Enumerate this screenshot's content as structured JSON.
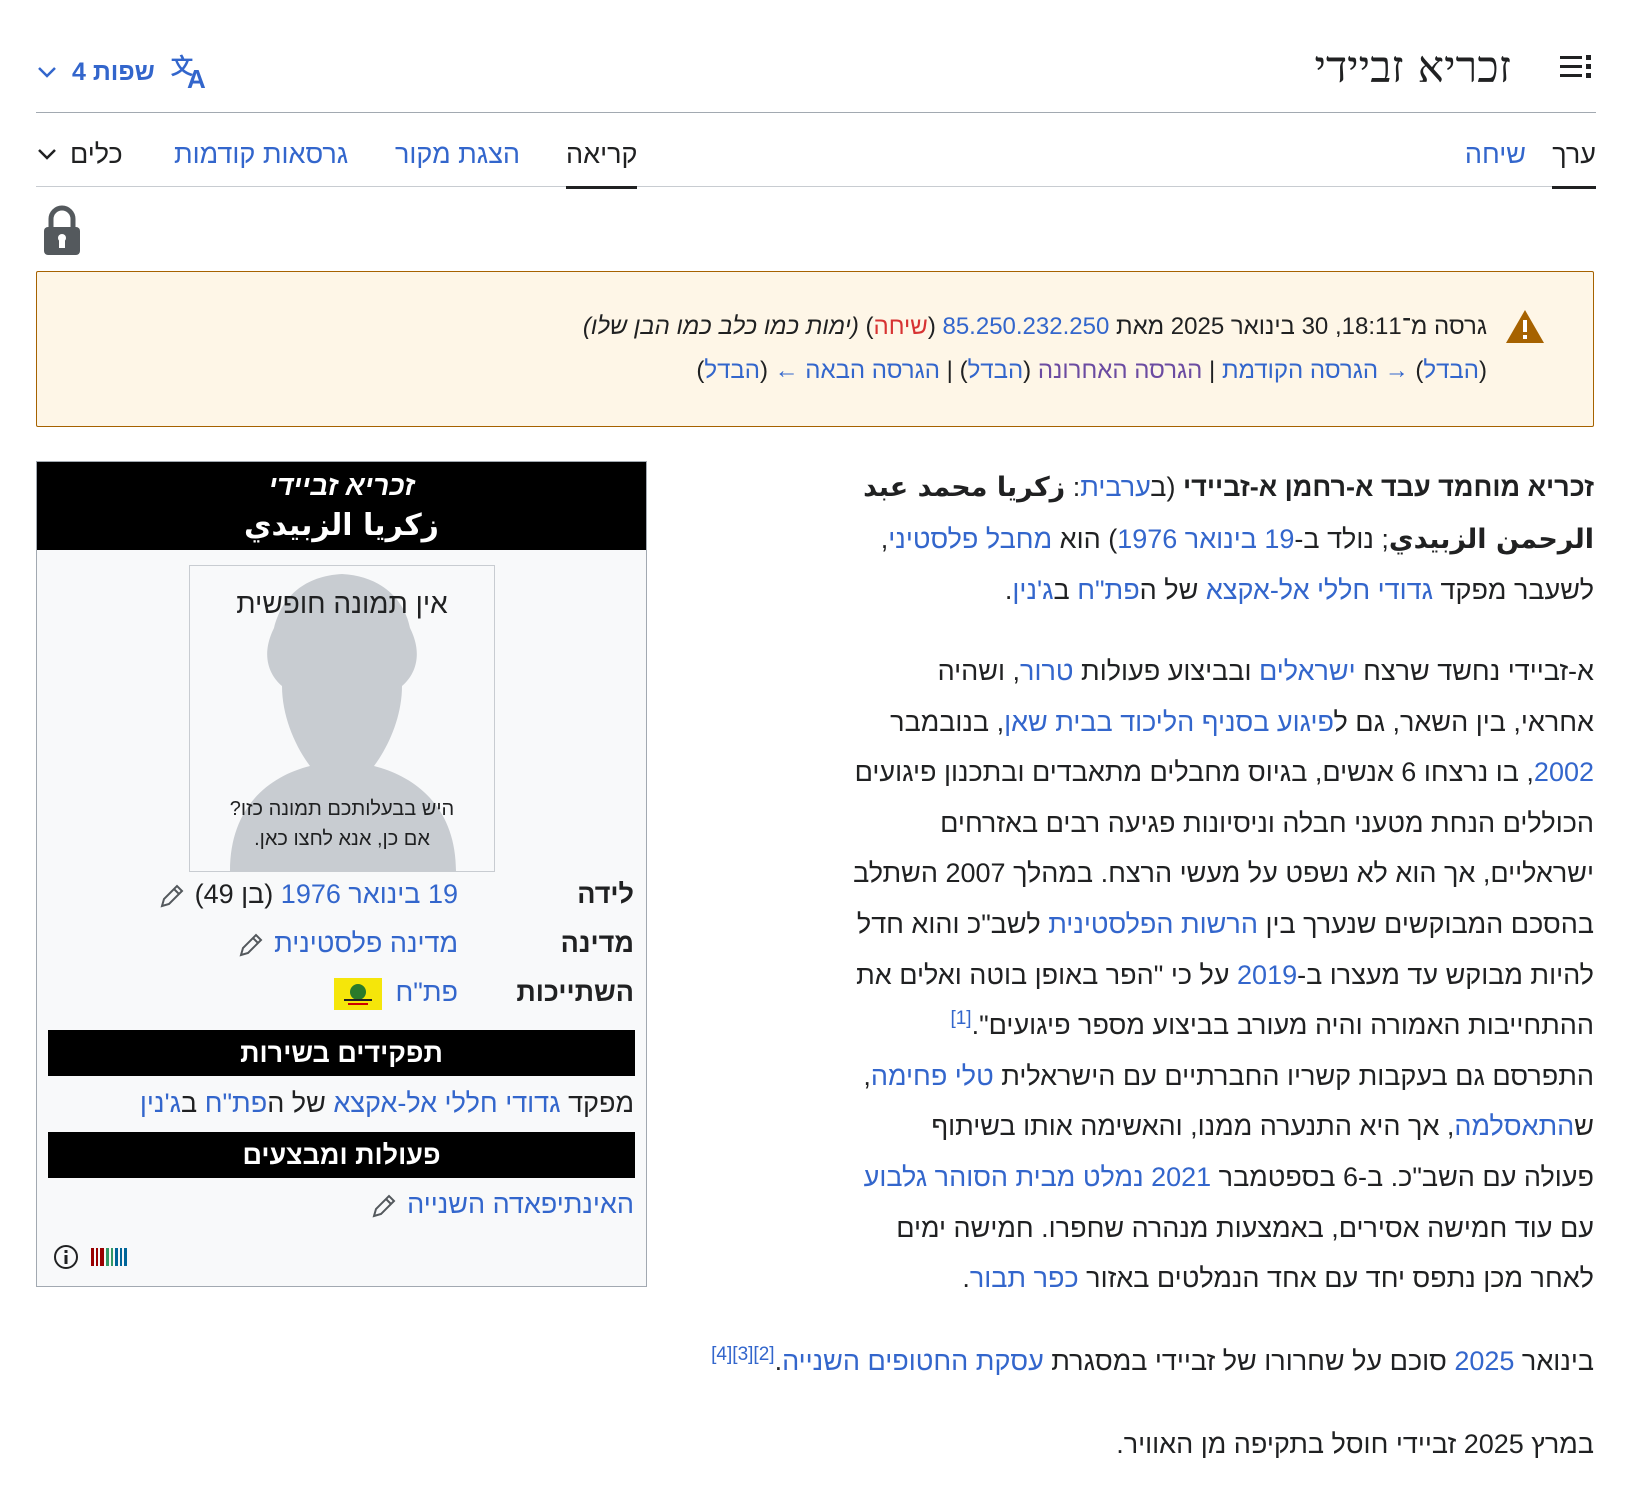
{
  "header": {
    "title": "זכריא זביידי",
    "languages_label": "4 שפות",
    "toc_icon": "toc-icon",
    "language_icon": "translate-icon"
  },
  "tabs": {
    "edit": "ערך",
    "talk": "שיחה",
    "read": "קריאה",
    "view_source": "הצגת מקור",
    "history": "גרסאות קודמות",
    "tools": "כלים"
  },
  "warning": {
    "l1_prefix": "גרסה מ־18:11, 30 בינואר 2025 מאת",
    "ip": "85.250.232.250",
    "talk_open": "(",
    "talk": "שיחה",
    "talk_close": ")",
    "summary": "(ימות כמו כלב כמו הבן שלו)",
    "diff1": "הבדל",
    "prev": "→ הגרסה הקודמת",
    "sep1": "|",
    "latest": "הגרסה האחרונה",
    "diff2": "הבדל",
    "sep2": "|",
    "next": "הגרסה הבאה ←",
    "diff3": "הבדל"
  },
  "infobox": {
    "title_he": "זכריא זביידי",
    "title_ar": "زكريا الزبيدي",
    "no_image": "אין תמונה חופשית",
    "ask_line1": "היש בבעלותכם תמונה כזו?",
    "ask_line2": "אם כן, אנא לחצו כאן.",
    "birth_label": "לידה",
    "birth_date": "19 בינואר 1976",
    "birth_age": "(בן 49)",
    "country_label": "מדינה",
    "country_value": "מדינה פלסטינית",
    "affiliation_label": "השתייכות",
    "affiliation_value": "פת\"ח",
    "roles_header": "תפקידים בשירות",
    "role_prefix": "מפקד",
    "role_unit": "גדודי חללי אל-אקצא",
    "role_of": "של ה",
    "role_party": "פת\"ח",
    "role_in": "ב",
    "role_place": "ג'נין",
    "ops_header": "פעולות ומבצעים",
    "ops_value": "האינתיפאדה השנייה"
  },
  "article": {
    "p1": {
      "name": "זכריא מוחמד עבד א-רחמן א-זביידי",
      "open_paren": " (ב",
      "arabic_link": "ערבית",
      "colon": ": ",
      "arabic_1": "زكريا محمد عبد",
      "arabic_2": "الرحمن الزبيدي",
      "born": "; נולד ב-",
      "date_link": "19 בינואר 1976",
      "is": ") הוא ",
      "militant_link": "מחבל פלסטיני",
      "comma": ",",
      "former": "לשעבר מפקד ",
      "unit_link": "גדודי חללי אל-אקצא",
      "of": " של ה",
      "party_link": "פת\"ח",
      "in": " ב",
      "place_link": "ג'נין",
      "dot": "."
    },
    "p2": {
      "a1": "א-זביידי נחשד שרצח ",
      "israelis": "ישראלים",
      "a2": " ובביצוע פעולות ",
      "terror": "טרור",
      "a3": ", ושהיה",
      "b1": "אחראי, בין השאר, גם ל",
      "attack": "פיגוע בסניף הליכוד בבית שאן",
      "b2": ", בנובמבר",
      "year2002": "2002",
      "c1": ", בו נרצחו 6 אנשים, בגיוס מחבלים מתאבדים ובתכנון פיגועים",
      "d1": "הכוללים הנחת מטעני חבלה וניסיונות פגיעה רבים באזרחים",
      "e1": "ישראליים, אך הוא לא נשפט על מעשי הרצח. במהלך 2007 השתלב",
      "f1": "בהסכם המבוקשים שנערך בין ",
      "pa": "הרשות הפלסטינית",
      "f2": " לשב\"כ והוא חדל",
      "g1": "להיות מבוקש עד מעצרו ב-",
      "year2019": "2019",
      "g2": " על כי \"הפר באופן בוטה ואלים את",
      "h1": "ההתחייבות האמורה והיה מעורב בביצוע מספר פיגועים\".",
      "ref1": "[1]",
      "i1": "התפרסם גם בעקבות קשריו החברתיים עם הישראלית ",
      "tali": "טלי פחימה",
      "i2": ",",
      "j1": "ש",
      "islam": "התאסלמה",
      "j2": ", אך היא התנערה ממנו, והאשימה אותו בשיתוף",
      "k1": "פעולה עם השב\"כ. ב-6 בספטמבר ",
      "escape": "2021 נמלט מבית הסוהר גלבוע",
      "l1": "עם עוד חמישה אסירים, באמצעות מנהרה שחפרו. חמישה ימים",
      "m1": "לאחר מכן נתפס יחד עם אחד הנמלטים באזור ",
      "kafr": "כפר תבור",
      "m2": "."
    },
    "p3": {
      "a1": "בינואר ",
      "year2025": "2025",
      "a2": " סוכם על שחרורו של זביידי במסגרת ",
      "deal": "עסקת החטופים השנייה",
      "dot": ".",
      "refs": "[2][3][4]"
    },
    "p4": {
      "text": "במרץ 2025 זביידי חוסל בתקיפה מן האוויר."
    }
  },
  "colors": {
    "link": "#3366cc",
    "red_link": "#d73333",
    "visited": "#6b4ba1",
    "warning_bg": "#fef6e7",
    "warning_border": "#a66200"
  }
}
